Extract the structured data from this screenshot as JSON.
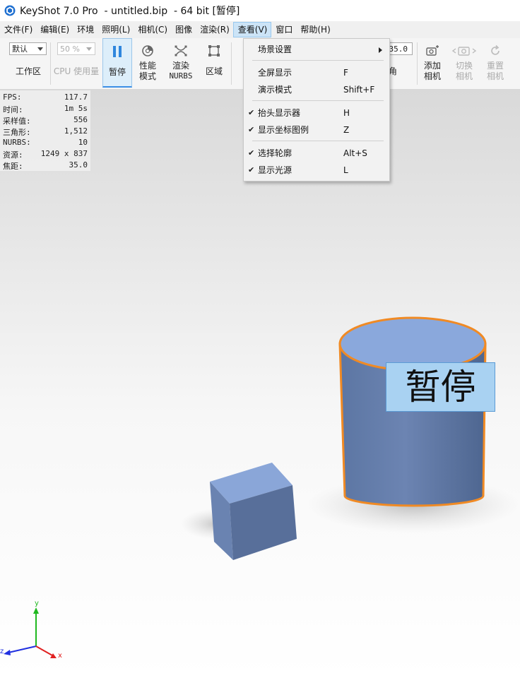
{
  "window": {
    "title": "KeyShot 7.0 Pro  - untitled.bip  - 64 bit [暂停]"
  },
  "menubar": {
    "items": [
      "文件(F)",
      "编辑(E)",
      "环境",
      "照明(L)",
      "相机(C)",
      "图像",
      "渲染(R)",
      "查看(V)",
      "窗口",
      "帮助(H)"
    ]
  },
  "toolbar": {
    "preset_value": "默认",
    "cpu_value": "50 %",
    "workspace_label": "工作区",
    "cpu_usage_label": "CPU 使用量",
    "pause_label": "暂停",
    "perf_label_1": "性能",
    "perf_label_2": "模式",
    "render_label_1": "渲染",
    "render_label_2": "NURBS",
    "region_label": "区域",
    "focal_value": "35.0",
    "angle_label": "角",
    "add_camera_1": "添加",
    "add_camera_2": "相机",
    "switch_camera_1": "切换",
    "switch_camera_2": "相机",
    "reset_camera_1": "重置",
    "reset_camera_2": "相机"
  },
  "stats": [
    {
      "key": "FPS:",
      "value": "117.7"
    },
    {
      "key": "时间:",
      "value": "1m 5s"
    },
    {
      "key": "采样值:",
      "value": "556"
    },
    {
      "key": "三角形:",
      "value": "1,512"
    },
    {
      "key": "NURBS:",
      "value": "10"
    },
    {
      "key": "资源:",
      "value": "1249 x 837"
    },
    {
      "key": "焦距:",
      "value": "35.0"
    }
  ],
  "view_menu": [
    {
      "label": "场景设置",
      "shortcut": "",
      "checked": false,
      "submenu": true
    },
    {
      "label": "全屏显示",
      "shortcut": "F",
      "checked": false
    },
    {
      "label": "演示模式",
      "shortcut": "Shift+F",
      "checked": false
    },
    {
      "label": "抬头显示器",
      "shortcut": "H",
      "checked": true
    },
    {
      "label": "显示坐标图例",
      "shortcut": "Z",
      "checked": true
    },
    {
      "label": "选择轮廓",
      "shortcut": "Alt+S",
      "checked": true
    },
    {
      "label": "显示光源",
      "shortcut": "L",
      "checked": true
    }
  ],
  "check_glyph": "✔",
  "overlay": {
    "pause_text": "暂停"
  },
  "axes": {
    "y": "y",
    "z": "z",
    "x": "x"
  },
  "colors": {
    "model": "#6e86b3",
    "selection_outline": "#f08a24",
    "accent": "#3a8ee6"
  }
}
